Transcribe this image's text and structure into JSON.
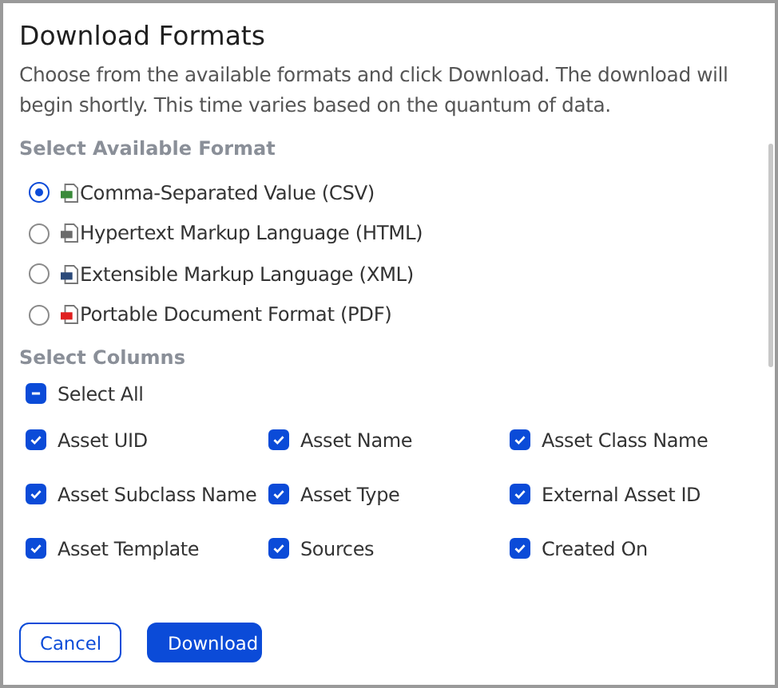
{
  "dialog": {
    "title": "Download Formats",
    "description": "Choose from the available formats and click Download. The download will begin shortly. This time varies based on the quantum of data."
  },
  "format_section": {
    "heading": "Select Available Format",
    "options": [
      {
        "label": "Comma-Separated Value (CSV)",
        "selected": true,
        "color": "#3a8a3a"
      },
      {
        "label": "Hypertext Markup Language (HTML)",
        "selected": false,
        "color": "#6b6b6b"
      },
      {
        "label": "Extensible Markup Language (XML)",
        "selected": false,
        "color": "#2c4a7a"
      },
      {
        "label": "Portable Document Format (PDF)",
        "selected": false,
        "color": "#e02020"
      }
    ]
  },
  "columns_section": {
    "heading": "Select Columns",
    "select_all": {
      "label": "Select All",
      "checked": true,
      "partial": true
    },
    "columns": [
      {
        "label": "Asset UID",
        "checked": true
      },
      {
        "label": "Asset Name",
        "checked": true
      },
      {
        "label": "Asset Class Name",
        "checked": true
      },
      {
        "label": "Asset Subclass Name",
        "checked": true
      },
      {
        "label": "Asset Type",
        "checked": true
      },
      {
        "label": "External Asset ID",
        "checked": true
      },
      {
        "label": "Asset Template",
        "checked": true
      },
      {
        "label": "Sources",
        "checked": true
      },
      {
        "label": "Created On",
        "checked": true
      }
    ]
  },
  "buttons": {
    "cancel": "Cancel",
    "download": "Download"
  }
}
